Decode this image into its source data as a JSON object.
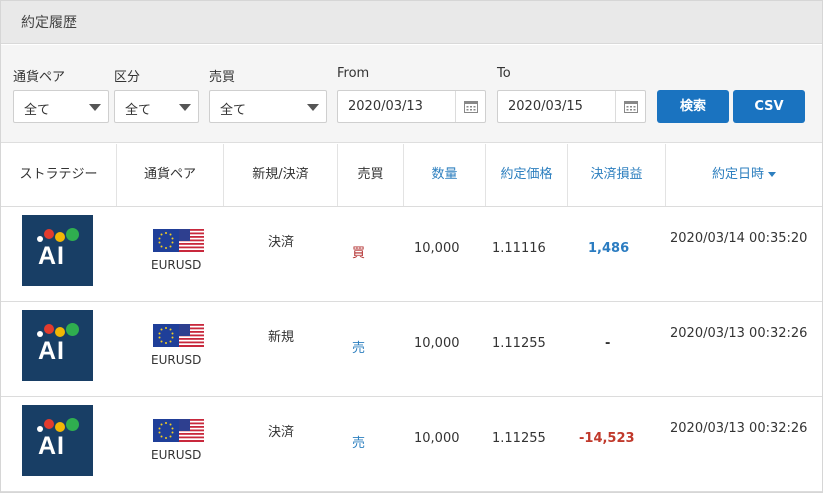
{
  "panel": {
    "title": "約定履歴"
  },
  "filters": {
    "currency_pair": {
      "label": "通貨ペア",
      "value": "全て"
    },
    "category": {
      "label": "区分",
      "value": "全て"
    },
    "side": {
      "label": "売買",
      "value": "全て"
    },
    "from": {
      "label": "From",
      "value": "2020/03/13"
    },
    "to": {
      "label": "To",
      "value": "2020/03/15"
    },
    "search_button": "検索",
    "csv_button": "CSV"
  },
  "table": {
    "columns": [
      "ストラテジー",
      "通貨ペア",
      "新規/決済",
      "売買",
      "数量",
      "約定価格",
      "決済損益",
      "約定日時"
    ],
    "sorted_column": "約定日時",
    "rows": [
      {
        "strategy_logo": "AI",
        "pair": "EURUSD",
        "type": "決済",
        "side": "買",
        "side_kind": "buy",
        "quantity": "10,000",
        "price": "1.11116",
        "pnl": "1,486",
        "pnl_kind": "positive",
        "datetime": "2020/03/14 00:35:20"
      },
      {
        "strategy_logo": "AI",
        "pair": "EURUSD",
        "type": "新規",
        "side": "売",
        "side_kind": "sell",
        "quantity": "10,000",
        "price": "1.11255",
        "pnl": "-",
        "pnl_kind": "none",
        "datetime": "2020/03/13 00:32:26"
      },
      {
        "strategy_logo": "AI",
        "pair": "EURUSD",
        "type": "決済",
        "side": "売",
        "side_kind": "sell",
        "quantity": "10,000",
        "price": "1.11255",
        "pnl": "-14,523",
        "pnl_kind": "negative",
        "datetime": "2020/03/13 00:32:26"
      }
    ]
  },
  "colors": {
    "accent": "#1a73c0",
    "header_link": "#2d7fbf",
    "buy": "#b02a2a",
    "sell": "#2d7fbf",
    "profit": "#2b7cc1",
    "loss": "#c0392b",
    "logo_bg": "#183e65"
  },
  "icons": {
    "calendar": "calendar-icon",
    "dropdown": "chevron-down-icon",
    "sort": "sort-desc-icon",
    "flag": "eu-us-flag-icon",
    "logo": "ai-strategy-logo"
  }
}
